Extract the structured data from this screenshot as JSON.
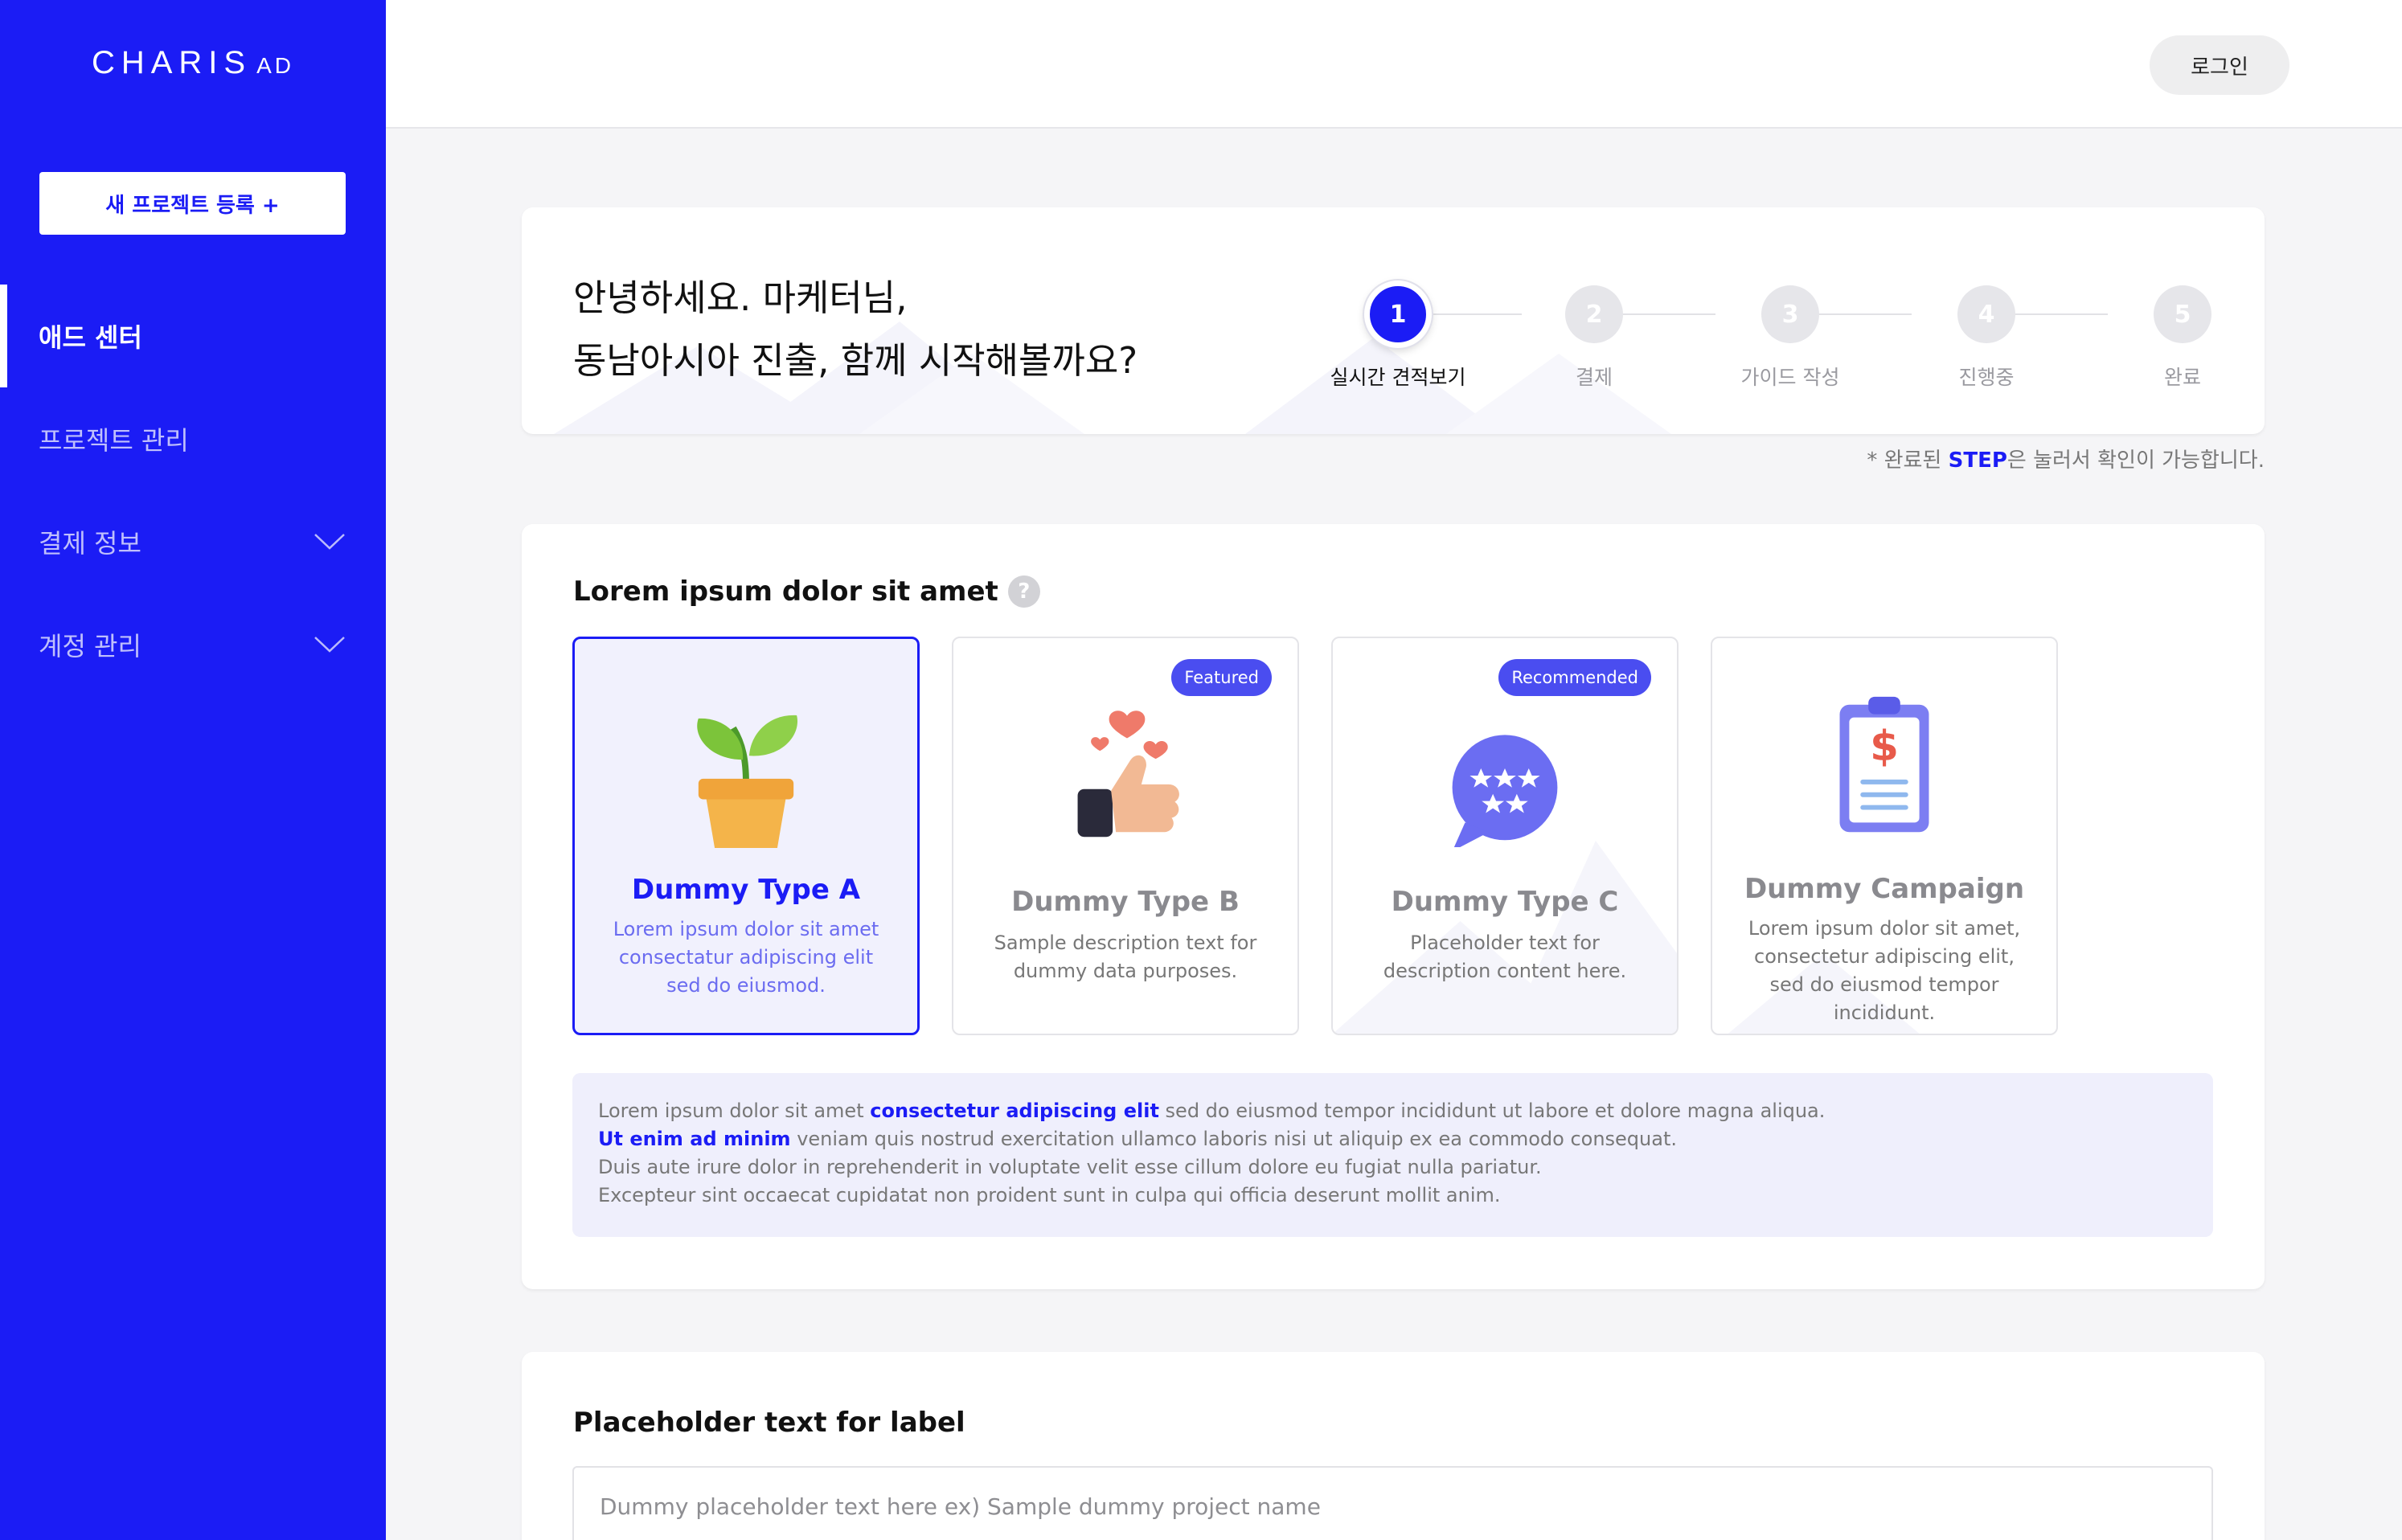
{
  "sidebar": {
    "logo_main": "CHARIS",
    "logo_sub": "AD",
    "new_project": "새 프로젝트 등록 +",
    "items": [
      {
        "label": "애드 센터",
        "active": true
      },
      {
        "label": "프로젝트 관리"
      },
      {
        "label": "결제 정보",
        "expandable": true
      },
      {
        "label": "계정 관리",
        "expandable": true
      }
    ]
  },
  "header": {
    "login": "로그인"
  },
  "hero": {
    "line1": "안녕하세요. 마케터님,",
    "line2": "동남아시아 진출, 함께 시작해볼까요?",
    "steps": [
      {
        "num": "1",
        "label": "실시간 견적보기",
        "active": true
      },
      {
        "num": "2",
        "label": "결제"
      },
      {
        "num": "3",
        "label": "가이드 작성"
      },
      {
        "num": "4",
        "label": "진행중"
      },
      {
        "num": "5",
        "label": "완료"
      }
    ],
    "hint_pre": "* 완료된 ",
    "hint_step": "STEP",
    "hint_post": "은 눌러서 확인이 가능합니다."
  },
  "selection": {
    "title": "Lorem ipsum dolor sit amet",
    "help": "?",
    "options": [
      {
        "title": "Dummy Type A",
        "desc": "Lorem ipsum dolor sit amet consectatur adipiscing elit sed do eiusmod.",
        "icon": "plant-pot-icon",
        "selected": true
      },
      {
        "title": "Dummy Type B",
        "desc": "Sample description text for dummy data purposes.",
        "badge": "Featured",
        "icon": "thumbs-up-hearts-icon"
      },
      {
        "title": "Dummy Type C",
        "desc": "Placeholder text for description content here.",
        "badge": "Recommended",
        "icon": "star-rating-bubble-icon"
      },
      {
        "title": "Dummy Campaign",
        "desc": "Lorem ipsum dolor sit amet, consectetur adipiscing elit, sed do eiusmod tempor incididunt.",
        "icon": "clipboard-invoice-icon"
      }
    ],
    "info": {
      "l1_a": "Lorem ipsum dolor sit amet ",
      "l1_hl": "consectetur adipiscing elit",
      "l1_b": " sed do eiusmod tempor incididunt ut labore et dolore magna aliqua.",
      "l2_hl": "Ut enim ad minim",
      "l2_b": " veniam quis nostrud exercitation ullamco laboris nisi ut aliquip ex ea commodo consequat.",
      "l3": "Duis aute irure dolor in reprehenderit in voluptate velit esse cillum dolore eu fugiat nulla pariatur.",
      "l4": "Excepteur sint occaecat cupidatat non proident sunt in culpa qui officia deserunt mollit anim."
    }
  },
  "label_section": {
    "title": "Placeholder text for label",
    "placeholder": "Dummy placeholder text here ex) Sample dummy project name"
  },
  "colors": {
    "brand": "#1b1cf5",
    "badge": "#4a4df0",
    "selected_bg": "#f1f1fd"
  }
}
